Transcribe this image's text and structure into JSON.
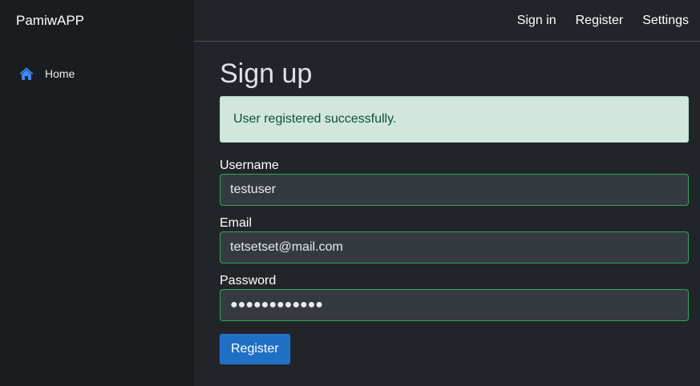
{
  "app": {
    "title": "PamiwAPP"
  },
  "sidebar": {
    "items": [
      {
        "label": "Home",
        "icon": "home-icon"
      }
    ]
  },
  "topnav": {
    "links": [
      "Sign in",
      "Register",
      "Settings"
    ]
  },
  "page": {
    "title": "Sign up",
    "alert": "User registered successfully."
  },
  "form": {
    "username": {
      "label": "Username",
      "value": "testuser"
    },
    "email": {
      "label": "Email",
      "value": "tetsetset@mail.com"
    },
    "password": {
      "label": "Password",
      "value": "●●●●●●●●●●●●"
    },
    "submit_label": "Register"
  },
  "colors": {
    "accent": "#1f6fc5",
    "success_border": "#2fa75a",
    "alert_bg": "#d1e7dd",
    "home_icon": "#3d8bfd"
  }
}
